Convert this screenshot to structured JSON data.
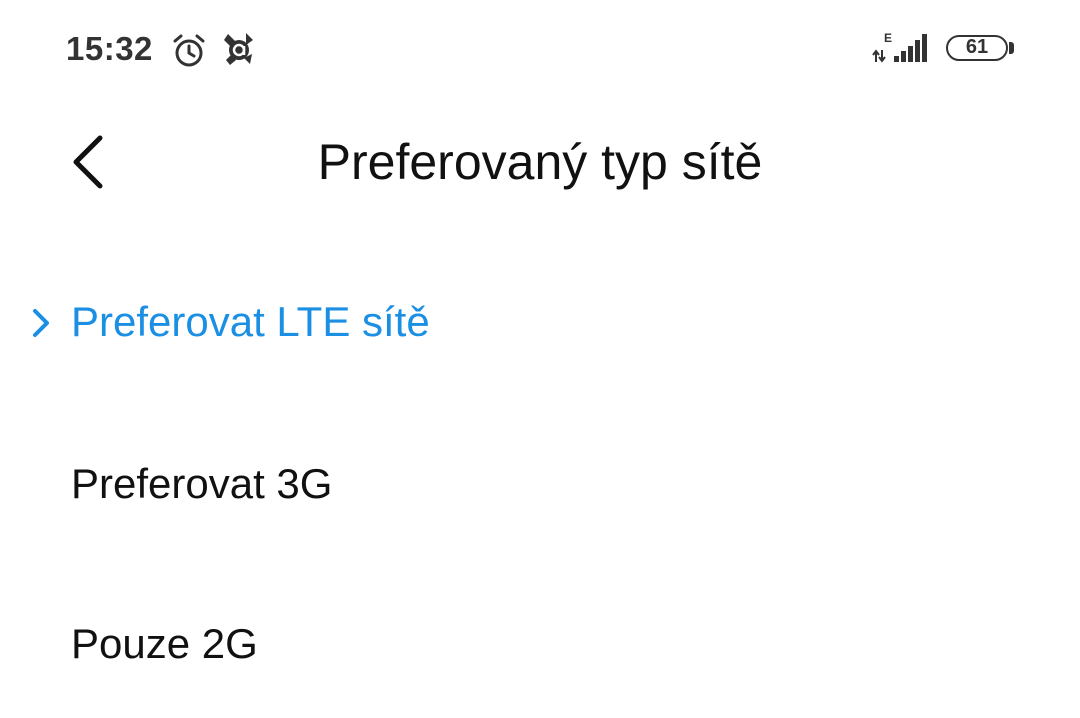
{
  "status_bar": {
    "time": "15:32",
    "network_type": "E",
    "battery_level": "61",
    "icons": [
      "alarm-icon",
      "avast-icon",
      "signal-icon",
      "battery-icon"
    ]
  },
  "header": {
    "title": "Preferovaný typ sítě",
    "back_icon": "chevron-left-icon"
  },
  "options": [
    {
      "label": "Preferovat LTE sítě",
      "selected": true
    },
    {
      "label": "Preferovat 3G",
      "selected": false
    },
    {
      "label": "Pouze 2G",
      "selected": false
    }
  ],
  "colors": {
    "accent": "#1a8fe3",
    "text": "#111111",
    "background": "#ffffff"
  }
}
